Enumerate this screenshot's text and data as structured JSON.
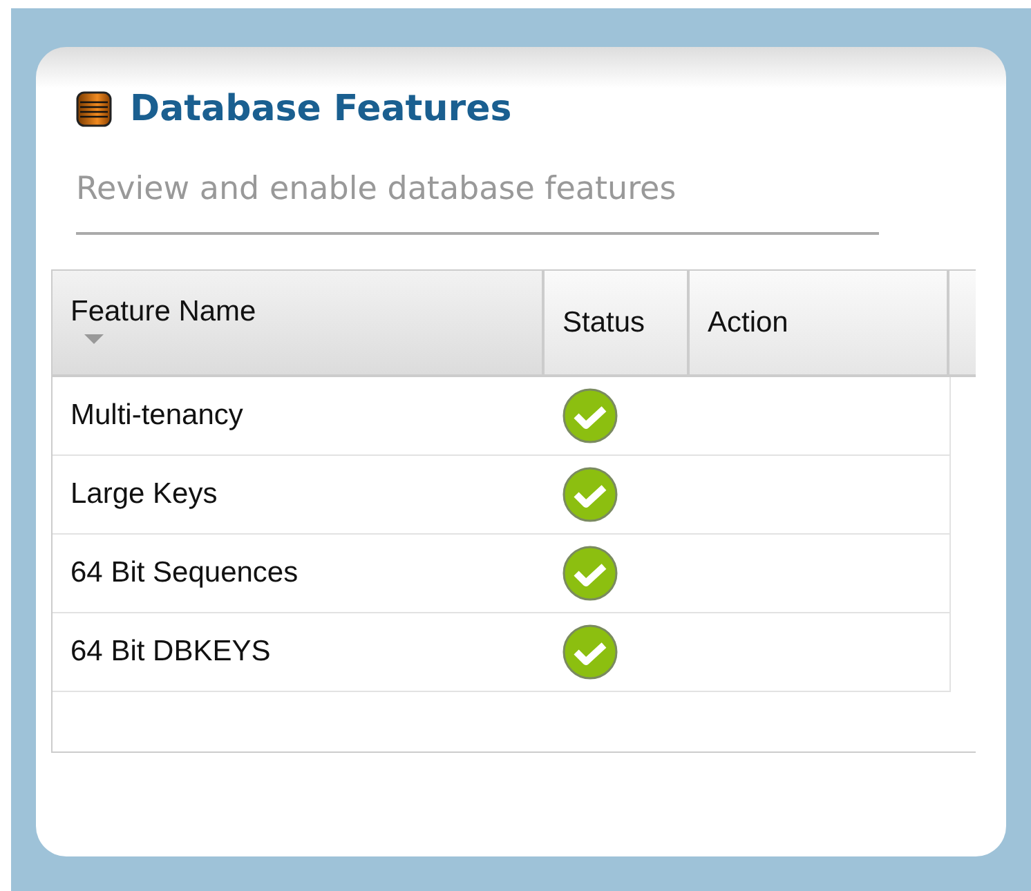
{
  "panel": {
    "title": "Database Features",
    "subtitle": "Review and enable database features"
  },
  "table": {
    "columns": [
      {
        "label": "Feature Name",
        "sorted": true
      },
      {
        "label": "Status",
        "sorted": false
      },
      {
        "label": "Action",
        "sorted": false
      }
    ],
    "rows": [
      {
        "name": "Multi-tenancy",
        "enabled": true
      },
      {
        "name": "Large Keys",
        "enabled": true
      },
      {
        "name": "64 Bit Sequences",
        "enabled": true
      },
      {
        "name": "64 Bit DBKEYS",
        "enabled": true
      }
    ]
  }
}
